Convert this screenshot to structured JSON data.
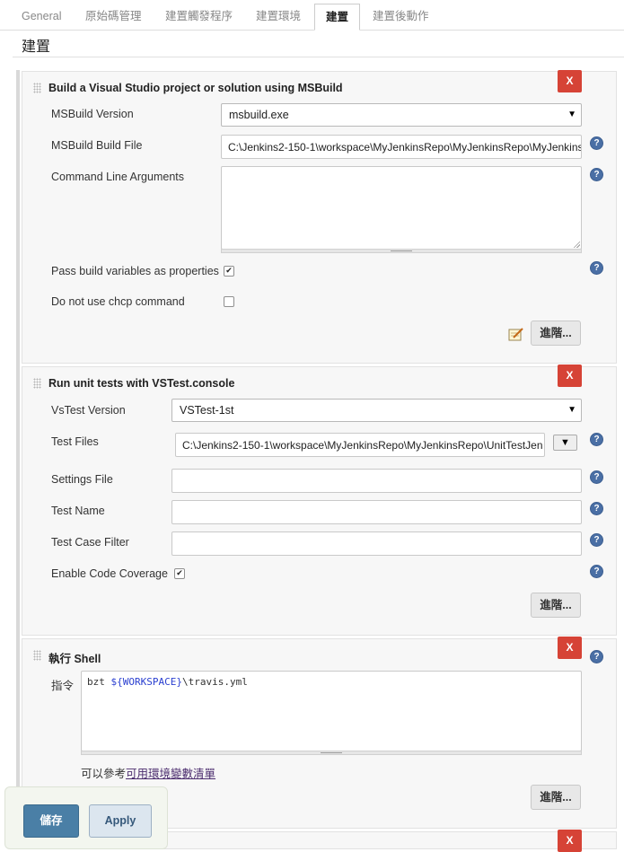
{
  "tabs": [
    {
      "label": "General"
    },
    {
      "label": "原始碼管理"
    },
    {
      "label": "建置觸發程序"
    },
    {
      "label": "建置環境"
    },
    {
      "label": "建置"
    },
    {
      "label": "建置後動作"
    }
  ],
  "page_title": "建置",
  "delete_label": "X",
  "help_glyph": "?",
  "advanced_label": "進階...",
  "msbuild": {
    "title": "Build a Visual Studio project or solution using MSBuild",
    "version_label": "MSBuild Version",
    "version_value": "msbuild.exe",
    "build_file_label": "MSBuild Build File",
    "build_file_value": "C:\\Jenkins2-150-1\\workspace\\MyJenkinsRepo\\MyJenkinsRepo\\MyJenkins",
    "cmd_args_label": "Command Line Arguments",
    "cmd_args_value": "",
    "pass_vars_label": "Pass build variables as properties",
    "pass_vars_checked": true,
    "no_chcp_label": "Do not use chcp command",
    "no_chcp_checked": false
  },
  "vstest": {
    "title": "Run unit tests with VSTest.console",
    "version_label": "VsTest Version",
    "version_value": "VSTest-1st",
    "test_files_label": "Test Files",
    "test_files_value": "C:\\Jenkins2-150-1\\workspace\\MyJenkinsRepo\\MyJenkinsRepo\\UnitTestJen",
    "settings_label": "Settings File",
    "settings_value": "",
    "test_name_label": "Test Name",
    "test_name_value": "",
    "filter_label": "Test Case Filter",
    "filter_value": "",
    "coverage_label": "Enable Code Coverage",
    "coverage_checked": true
  },
  "shell": {
    "title": "執行 Shell",
    "command_label": "指令",
    "command_prefix": "bzt ",
    "command_var": "${WORKSPACE}",
    "command_suffix": "\\travis.yml",
    "env_note_prefix": "可以參考",
    "env_link": "可用環境變數清單"
  },
  "footer": {
    "save_label": "儲存",
    "apply_label": "Apply"
  },
  "colors": {
    "delete_red": "#d64336",
    "save_blue": "#4a7fa6",
    "help_blue": "#4a6fa5"
  }
}
